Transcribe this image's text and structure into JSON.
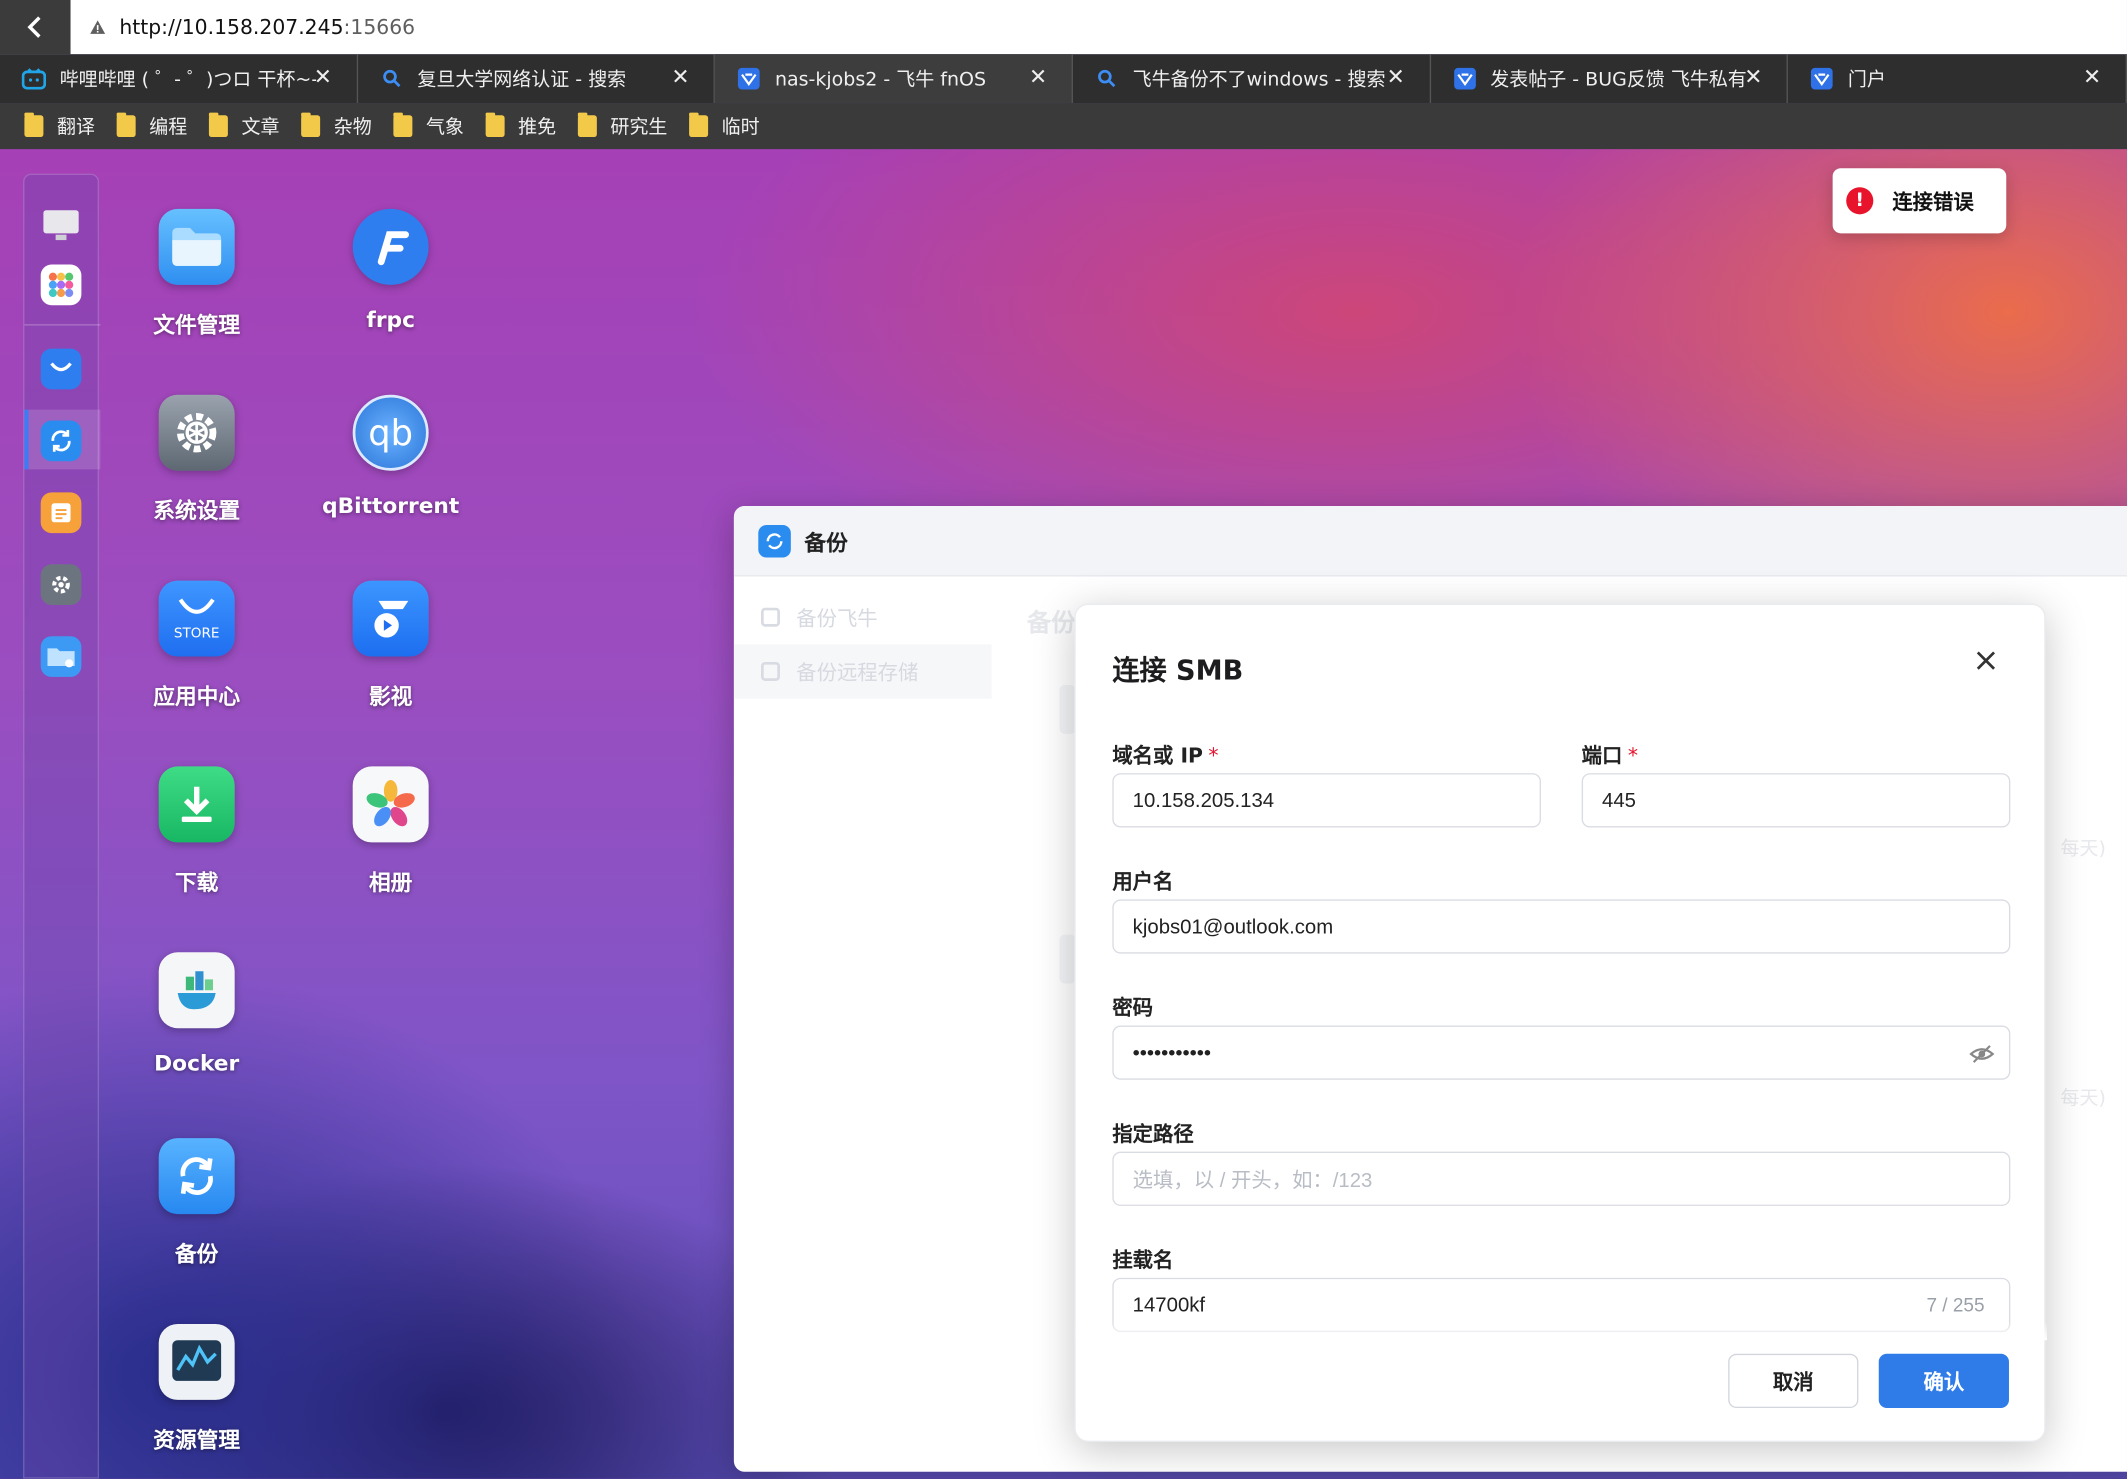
{
  "browser": {
    "url_host": "http://10.158.207.245",
    "url_port": ":15666",
    "tabs": [
      {
        "title": "哔哩哔哩 ( ゜- ゜)つロ 干杯~-b",
        "icon": "bilibili-icon"
      },
      {
        "title": "复旦大学网络认证 - 搜索",
        "icon": "search-icon"
      },
      {
        "title": "nas-kjobs2 - 飞牛 fnOS",
        "icon": "fnos-icon"
      },
      {
        "title": "飞牛备份不了windows - 搜索",
        "icon": "search-icon"
      },
      {
        "title": "发表帖子 - BUG反馈 飞牛私有",
        "icon": "fnos-icon"
      },
      {
        "title": "门户",
        "icon": "fnos-icon"
      }
    ],
    "bookmarks": [
      "翻译",
      "编程",
      "文章",
      "杂物",
      "气象",
      "推免",
      "研究生",
      "临时"
    ]
  },
  "desktop": {
    "apps": [
      {
        "label": "文件管理",
        "icon": "folder-icon"
      },
      {
        "label": "frpc",
        "icon": "frpc-icon"
      },
      {
        "label": "系统设置",
        "icon": "gear-icon"
      },
      {
        "label": "qBittorrent",
        "icon": "qbittorrent-icon"
      },
      {
        "label": "应用中心",
        "icon": "store-icon"
      },
      {
        "label": "影视",
        "icon": "video-icon"
      },
      {
        "label": "下载",
        "icon": "download-icon"
      },
      {
        "label": "相册",
        "icon": "photos-icon"
      },
      {
        "label": "Docker",
        "icon": "docker-icon"
      },
      {
        "label": "备份",
        "icon": "backup-icon"
      },
      {
        "label": "资源管理",
        "icon": "monitor-icon"
      }
    ],
    "store_text": "STORE"
  },
  "toast": {
    "text": "连接错误"
  },
  "window": {
    "title": "备份",
    "side_items": [
      "备份飞牛",
      "备份远程存储"
    ],
    "ghost_heading": "备份",
    "ghost_right_1": "每天)",
    "ghost_right_2": "每天)"
  },
  "modal": {
    "title": "连接 SMB",
    "host_label": "域名或 IP",
    "host_value": "10.158.205.134",
    "port_label": "端口",
    "port_value": "445",
    "user_label": "用户名",
    "user_value": "kjobs01@outlook.com",
    "password_label": "密码",
    "password_value": "•••••••••••",
    "path_label": "指定路径",
    "path_placeholder": "选填，以 / 开头，如：/123",
    "mount_label": "挂载名",
    "mount_value": "14700kf",
    "mount_count": "7 / 255",
    "required_mark": "*",
    "cancel_label": "取消",
    "confirm_label": "确认"
  },
  "colors": {
    "accent": "#2f7be8",
    "error": "#e8142b"
  }
}
